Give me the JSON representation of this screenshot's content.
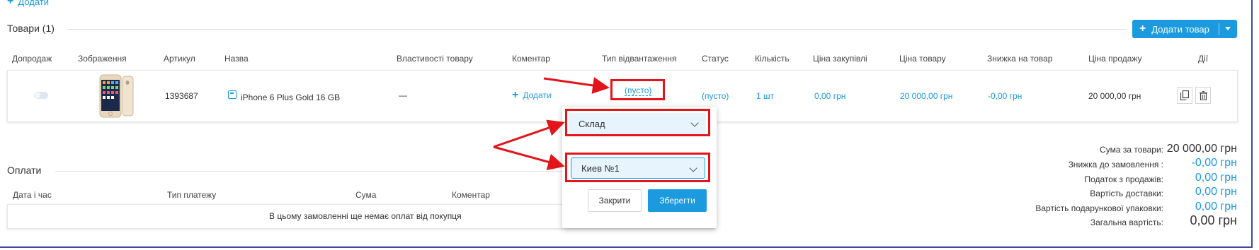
{
  "top_add_label": "Додати",
  "products": {
    "title": "Товари (1)",
    "add_button_label": "Додати товар",
    "headers": [
      "Допродаж",
      "Зображення",
      "Артикул",
      "Назва",
      "Властивості товару",
      "Коментар",
      "Тип відвантаження",
      "Статус",
      "Кількість",
      "Ціна закупівлі",
      "Ціна товару",
      "Знижка на товар",
      "Ціна продажу",
      "Дії"
    ],
    "row": {
      "sku": "1393687",
      "name": "iPhone 6 Plus Gold 16 GB",
      "properties": "—",
      "comment_add": "Додати",
      "shipment_type": "(пусто)",
      "status": "(пусто)",
      "quantity": "1 шт",
      "purchase_price": "0,00 грн",
      "product_price": "20 000,00 грн",
      "discount": "-0,00 грн",
      "sale_price": "20 000,00 грн"
    }
  },
  "popup": {
    "select_1": "Склад",
    "select_2": "Киев №1",
    "close_label": "Закрити",
    "save_label": "Зберегти"
  },
  "payments": {
    "title": "Оплати",
    "headers": [
      "Дата і час",
      "Тип платежу",
      "Сума",
      "Коментар"
    ],
    "empty": "В цьому замовленні ще немає оплат від покупця"
  },
  "summary": [
    {
      "label": "Сума за товари:",
      "value": "20 000,00 грн"
    },
    {
      "label": "Знижка до замовлення :",
      "value": "-0,00 грн"
    },
    {
      "label": "Податок з продажів:",
      "value": "0,00 грн"
    },
    {
      "label": "Вартість доставки:",
      "value": "0,00 грн"
    },
    {
      "label": "Вартість подарункової упаковки:",
      "value": "0,00 грн"
    },
    {
      "label": "Загальна вартість:",
      "value": "0,00 грн"
    }
  ],
  "colors": {
    "accent": "#1b9ae0",
    "highlight": "#e2151b"
  }
}
